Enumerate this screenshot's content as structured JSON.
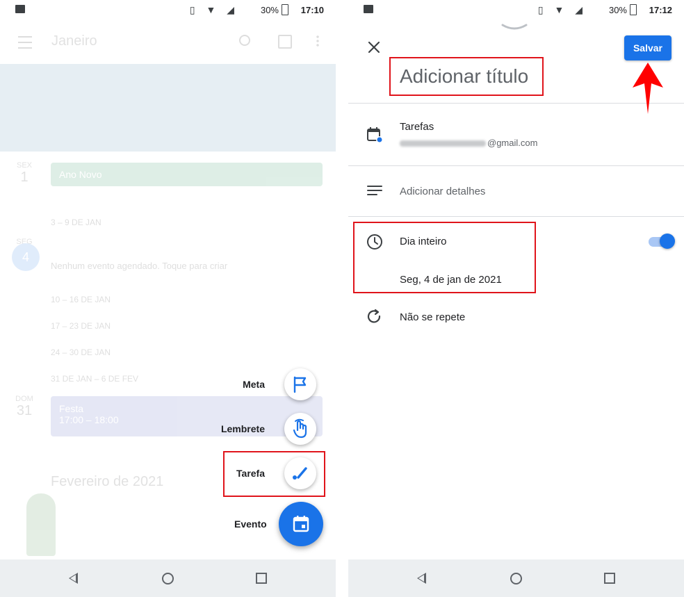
{
  "left": {
    "status": {
      "battery": "30%",
      "time": "17:10"
    },
    "toolbar": {
      "month": "Janeiro"
    },
    "background": {
      "date_1": {
        "dow": "SEX",
        "day": "1"
      },
      "event_1": "Ano Novo",
      "week_1": "3 – 9 DE JAN",
      "date_4": {
        "dow": "SEG",
        "day": "4"
      },
      "no_event": "Nenhum evento agendado. Toque para criar",
      "week_2": "10 – 16 DE JAN",
      "week_3": "17 – 23 DE JAN",
      "week_4": "24 – 30 DE JAN",
      "week_5": "31 DE JAN – 6 DE FEV",
      "date_31": {
        "dow": "DOM",
        "day": "31"
      },
      "event_2": {
        "title": "Festa",
        "time": "17:00 – 18:00"
      },
      "month_header": "Fevereiro de 2021"
    },
    "speed_dial": {
      "goal": "Meta",
      "reminder": "Lembrete",
      "task": "Tarefa",
      "event": "Evento"
    },
    "icons": {
      "goal": "flag-icon",
      "reminder": "hand-icon",
      "task": "check-icon",
      "event": "calendar-icon"
    }
  },
  "right": {
    "status": {
      "battery": "30%",
      "time": "17:12"
    },
    "save_label": "Salvar",
    "title_placeholder": "Adicionar título",
    "task_list": {
      "name": "Tarefas",
      "email_suffix": "@gmail.com"
    },
    "details_placeholder": "Adicionar detalhes",
    "all_day": {
      "label": "Dia inteiro",
      "enabled": true
    },
    "date": "Seg, 4 de jan de 2021",
    "repeat": "Não se repete"
  },
  "colors": {
    "accent": "#1a73e8",
    "highlight_box": "#e0141b",
    "arrow": "#ff0000"
  }
}
